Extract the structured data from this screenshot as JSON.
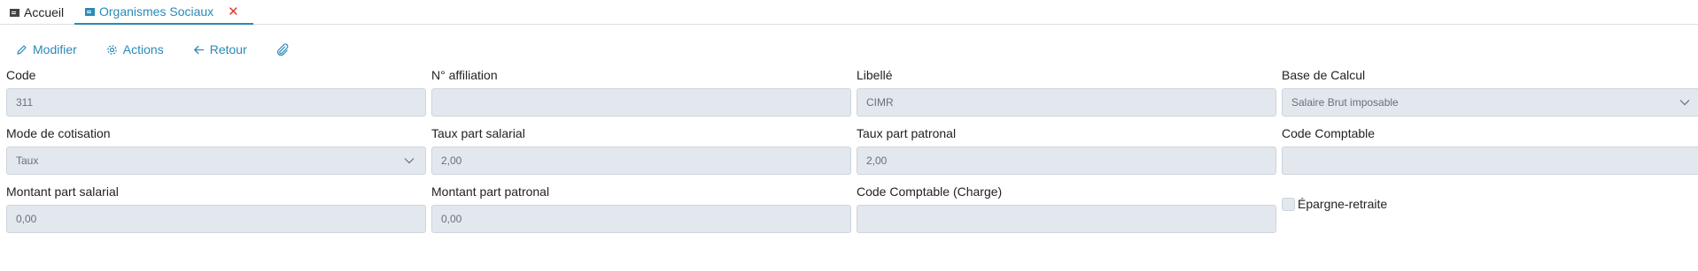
{
  "tabs": {
    "home_label": "Accueil",
    "active_label": "Organismes Sociaux",
    "close_glyph": "✕"
  },
  "toolbar": {
    "edit_label": "Modifier",
    "actions_label": "Actions",
    "back_label": "Retour",
    "attach_icon": "paperclip-icon"
  },
  "form": {
    "code": {
      "label": "Code",
      "value": "311"
    },
    "affiliation": {
      "label": "N° affiliation",
      "value": ""
    },
    "libelle": {
      "label": "Libellé",
      "value": "CIMR"
    },
    "base_calcul": {
      "label": "Base de Calcul",
      "value": "Salaire Brut imposable"
    },
    "mode_cotisation": {
      "label": "Mode de cotisation",
      "value": "Taux"
    },
    "taux_salarial": {
      "label": "Taux part salarial",
      "value": "2,00"
    },
    "taux_patronal": {
      "label": "Taux part patronal",
      "value": "2,00"
    },
    "code_comptable": {
      "label": "Code Comptable",
      "value": ""
    },
    "montant_salarial": {
      "label": "Montant part salarial",
      "value": "0,00"
    },
    "montant_patronal": {
      "label": "Montant part patronal",
      "value": "0,00"
    },
    "code_comptable_charge": {
      "label": "Code Comptable (Charge)",
      "value": ""
    },
    "epargne_retraite": {
      "label": "Épargne-retraite",
      "checked": false
    }
  },
  "colors": {
    "accent": "#2a8ab5",
    "close": "#e0392b",
    "input_bg": "#e3e8ef"
  }
}
